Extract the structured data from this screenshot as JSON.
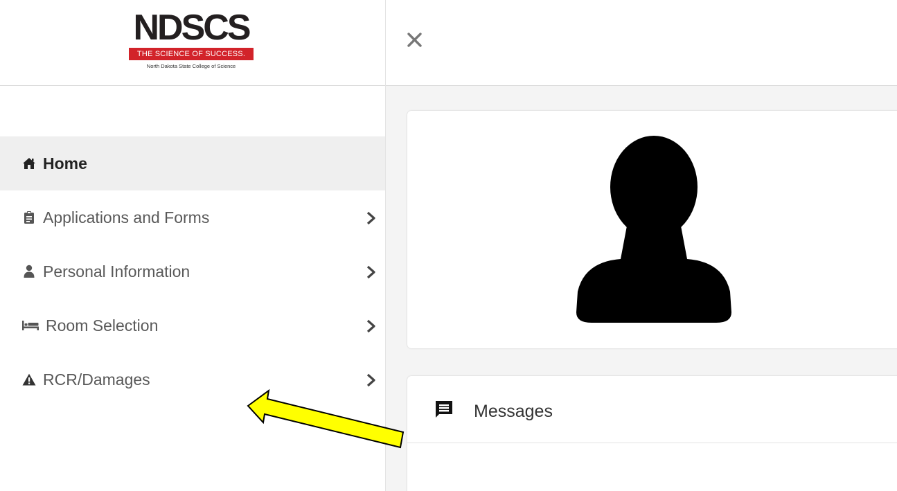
{
  "logo": {
    "wordmark": "NDSCS",
    "tagline": "THE SCIENCE OF SUCCESS.",
    "institution": "North Dakota State College of Science"
  },
  "sidebar": {
    "items": [
      {
        "label": "Home",
        "icon": "home-icon",
        "active": true,
        "has_chevron": false
      },
      {
        "label": "Applications and Forms",
        "icon": "clipboard-icon",
        "active": false,
        "has_chevron": true
      },
      {
        "label": "Personal Information",
        "icon": "user-icon",
        "active": false,
        "has_chevron": true
      },
      {
        "label": "Room Selection",
        "icon": "bed-icon",
        "active": false,
        "has_chevron": true
      },
      {
        "label": "RCR/Damages",
        "icon": "warning-icon",
        "active": false,
        "has_chevron": true
      }
    ]
  },
  "topbar": {
    "close_icon": "close-icon"
  },
  "main": {
    "profile_card": {
      "avatar_icon": "avatar-placeholder-icon"
    },
    "messages_card": {
      "title": "Messages",
      "icon": "message-icon"
    }
  },
  "colors": {
    "brand_red": "#d2232a",
    "annotation_arrow_fill": "#ffff00",
    "active_nav_bg": "#efefef"
  }
}
